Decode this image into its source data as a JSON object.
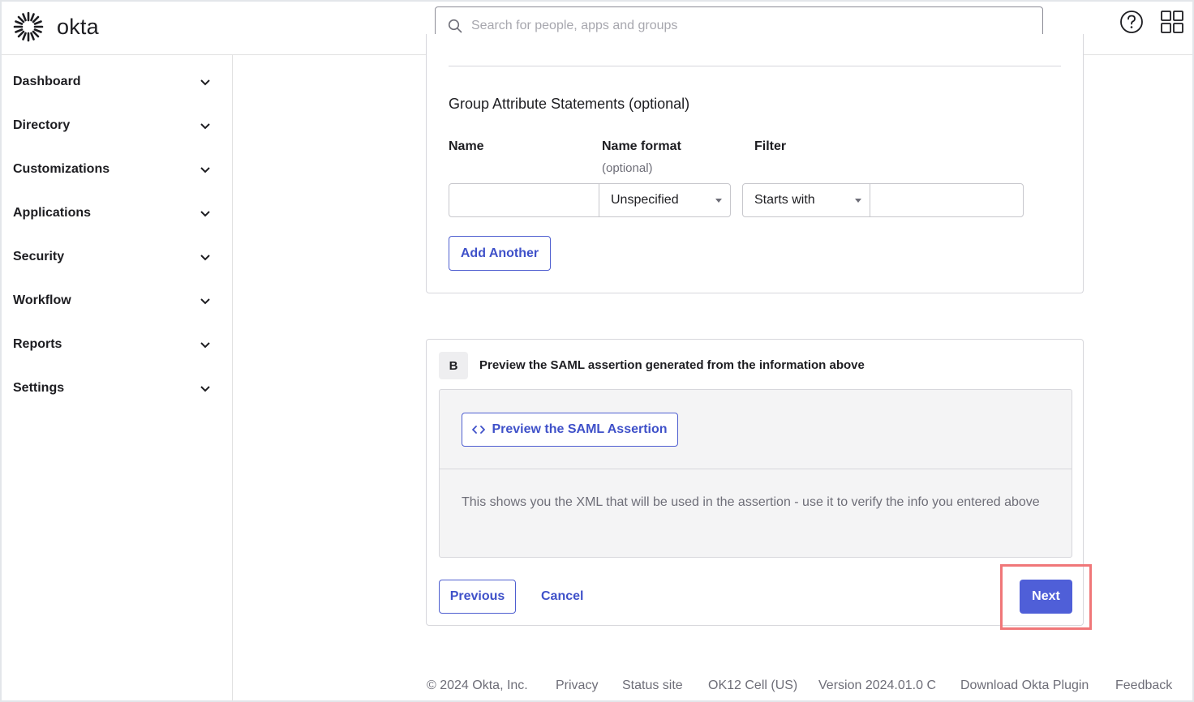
{
  "header": {
    "logo_text": "okta",
    "search_placeholder": "Search for people, apps and groups",
    "help_icon": "help-circle-icon",
    "apps_icon": "grid-apps-icon"
  },
  "sidebar": {
    "items": [
      {
        "label": "Dashboard"
      },
      {
        "label": "Directory"
      },
      {
        "label": "Customizations"
      },
      {
        "label": "Applications"
      },
      {
        "label": "Security"
      },
      {
        "label": "Workflow"
      },
      {
        "label": "Reports"
      },
      {
        "label": "Settings"
      }
    ]
  },
  "group_attributes": {
    "title": "Group Attribute Statements (optional)",
    "col_name": "Name",
    "col_format": "Name format",
    "col_format_sub": "(optional)",
    "col_filter": "Filter",
    "name_value": "",
    "format_value": "Unspecified",
    "filter_type_value": "Starts with",
    "filter_value": "",
    "add_another": "Add Another"
  },
  "preview": {
    "step_letter": "B",
    "step_title": "Preview the SAML assertion generated from the information above",
    "button_label": "Preview the SAML Assertion",
    "description": "This shows you the XML that will be used in the assertion - use it to verify the info you entered above"
  },
  "actions": {
    "previous": "Previous",
    "cancel": "Cancel",
    "next": "Next"
  },
  "footer": {
    "copyright": "© 2024 Okta, Inc.",
    "privacy": "Privacy",
    "status": "Status site",
    "cell": "OK12 Cell (US)",
    "version": "Version 2024.01.0 C",
    "plugin": "Download Okta Plugin",
    "feedback": "Feedback"
  },
  "colors": {
    "accent": "#4f5fd8",
    "highlight": "#f07779"
  }
}
